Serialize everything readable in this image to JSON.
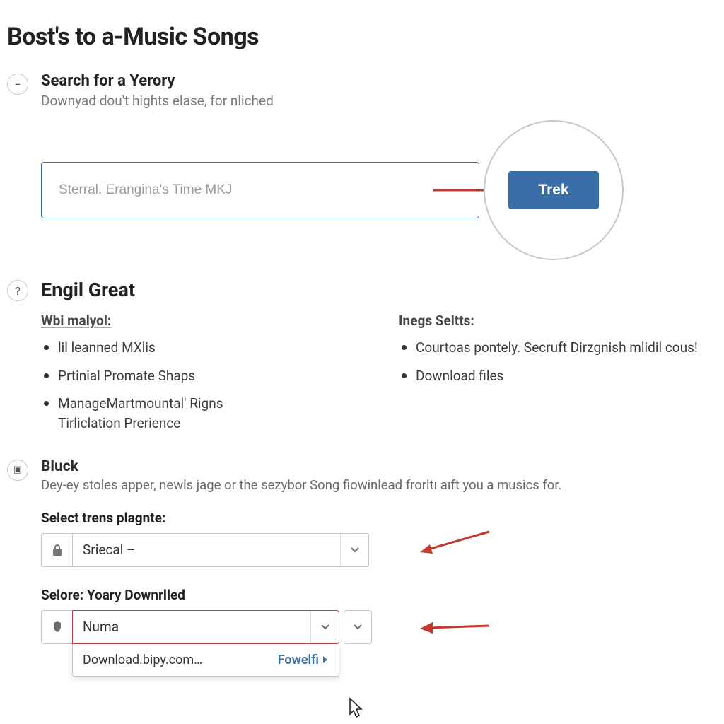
{
  "page": {
    "title": "Bost's to a-Music Songs"
  },
  "step1": {
    "icon": "−",
    "title": "Search for a Yerory",
    "subtitle": "Downyad dou't hights elase, for nliched",
    "search": {
      "placeholder": "Sterral. Erangina's Time MKJ"
    },
    "button": "Trek"
  },
  "step2": {
    "icon": "?",
    "title": "Engil Great",
    "left": {
      "heading": "Wbi malyol:",
      "items": [
        "lil leanned MXlis",
        "Prtinial Promate Shaps",
        "ManageMartmountal' Rigns",
        "Tirliclation Prerience"
      ]
    },
    "right": {
      "heading": "Inegs Seltts:",
      "items": [
        "Courtoas pontely. Secruft Dirzgnish mlidil cous!",
        "Download files"
      ]
    }
  },
  "step3": {
    "icon": "▣",
    "title": "Bluck",
    "subtitle": "Dey-ey stoles apper, newls jage or the sezybor Song fiowinlead frorltı aıft you a musics for.",
    "field1": {
      "label": "Select trens plagnte:",
      "value": "Sriecal –"
    },
    "field2": {
      "label": "Selore: Yoary Downrlled",
      "value": "Numa",
      "option": "Download.bipy.com…",
      "link": "Fowelfi"
    }
  }
}
